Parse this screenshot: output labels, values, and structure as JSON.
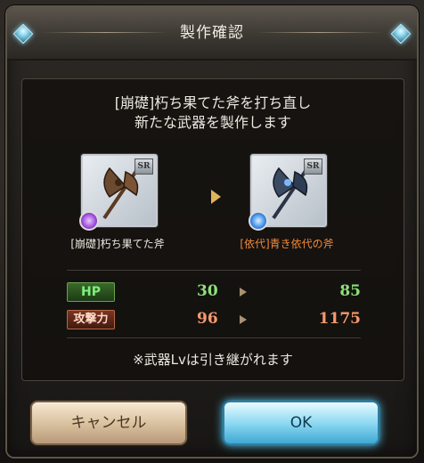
{
  "dialog": {
    "title": "製作確認",
    "message_line1": "[崩礎]朽ち果てた斧を打ち直し",
    "message_line2": "新たな武器を製作します",
    "note": "※武器Lvは引き継がれます"
  },
  "source_weapon": {
    "name": "[崩礎]朽ち果てた斧",
    "rarity": "SR",
    "name_color": "#ece8df",
    "element_color": "#9a4ad8",
    "icon": "axe-icon"
  },
  "result_weapon": {
    "name": "[依代]青き依代の斧",
    "rarity": "SR",
    "name_color": "#f08a3a",
    "element_color": "#3a8ae8",
    "icon": "axe-icon"
  },
  "stats": {
    "hp": {
      "label": "HP",
      "before": "30",
      "after": "85"
    },
    "attack": {
      "label": "攻撃力",
      "before": "96",
      "after": "1175"
    }
  },
  "buttons": {
    "cancel": "キャンセル",
    "ok": "OK"
  }
}
